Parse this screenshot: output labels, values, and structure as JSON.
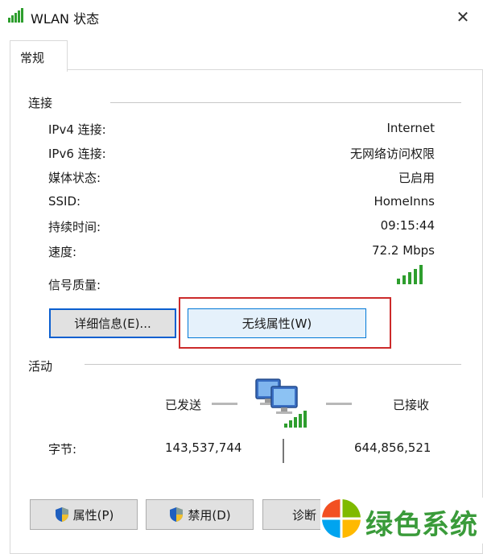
{
  "window": {
    "title": "WLAN 状态",
    "close_symbol": "✕"
  },
  "tabs": [
    {
      "label": "常规"
    }
  ],
  "connection": {
    "section_title": "连接",
    "rows": [
      {
        "label": "IPv4 连接:",
        "value": "Internet"
      },
      {
        "label": "IPv6 连接:",
        "value": "无网络访问权限"
      },
      {
        "label": "媒体状态:",
        "value": "已启用"
      },
      {
        "label": "SSID:",
        "value": "HomeInns"
      },
      {
        "label": "持续时间:",
        "value": "09:15:44"
      },
      {
        "label": "速度:",
        "value": "72.2 Mbps"
      }
    ],
    "signal_label": "信号质量:",
    "signal_bars": 5,
    "details_button": "详细信息(E)...",
    "wireless_properties_button": "无线属性(W)"
  },
  "activity": {
    "section_title": "活动",
    "sent_label": "已发送",
    "received_label": "已接收",
    "bytes_label": "字节:",
    "bytes_sent": "143,537,744",
    "bytes_received": "644,856,521"
  },
  "footer": {
    "properties_button": "属性(P)",
    "disable_button": "禁用(D)",
    "diagnose_button": "诊断"
  },
  "watermark": {
    "text": "绿色系统"
  },
  "colors": {
    "highlight": "#cc2a2a",
    "accent": "#0078d7",
    "signal_green": "#2e9e2e",
    "watermark_green": "#3a9b3a"
  }
}
